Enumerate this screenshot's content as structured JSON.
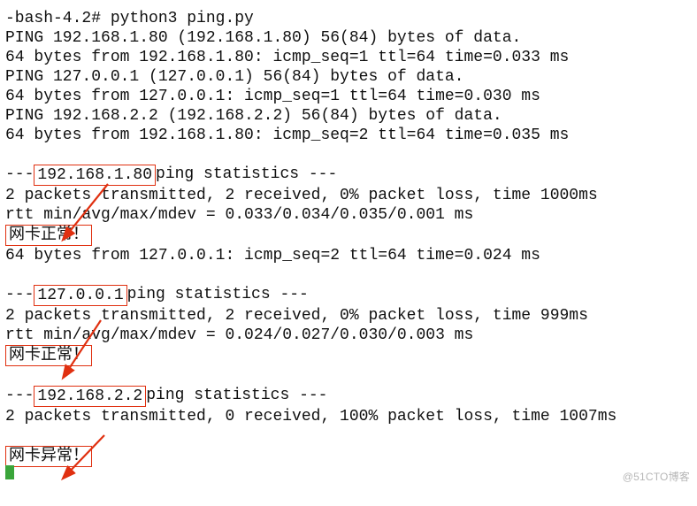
{
  "prompt": "-bash-4.2# python3 ping.py",
  "lines": {
    "ping_a_header": "PING 192.168.1.80 (192.168.1.80) 56(84) bytes of data.",
    "ping_a_reply1": "64 bytes from 192.168.1.80: icmp_seq=1 ttl=64 time=0.033 ms",
    "ping_b_header": "PING 127.0.0.1 (127.0.0.1) 56(84) bytes of data.",
    "ping_b_reply1": "64 bytes from 127.0.0.1: icmp_seq=1 ttl=64 time=0.030 ms",
    "ping_c_header": "PING 192.168.2.2 (192.168.2.2) 56(84) bytes of data.",
    "ping_a_reply2": "64 bytes from 192.168.1.80: icmp_seq=2 ttl=64 time=0.035 ms",
    "ping_b_reply2": "64 bytes from 127.0.0.1: icmp_seq=2 ttl=64 time=0.024 ms"
  },
  "blocks": [
    {
      "sep_prefix": "--- ",
      "ip": "192.168.1.80",
      "sep_suffix": " ping statistics ---",
      "stats": "2 packets transmitted, 2 received, 0% packet loss, time 1000ms",
      "rtt": "rtt min/avg/max/mdev = 0.033/0.034/0.035/0.001 ms",
      "status": "网卡正常！"
    },
    {
      "sep_prefix": "--- ",
      "ip": "127.0.0.1",
      "sep_suffix": " ping statistics ---",
      "stats": "2 packets transmitted, 2 received, 0% packet loss, time 999ms",
      "rtt": "rtt min/avg/max/mdev = 0.024/0.027/0.030/0.003 ms",
      "status": "网卡正常！"
    },
    {
      "sep_prefix": "--- ",
      "ip": "192.168.2.2",
      "sep_suffix": " ping statistics ---",
      "stats": "2 packets transmitted, 0 received, 100% packet loss, time 1007ms",
      "rtt": "",
      "status": "网卡异常！"
    }
  ],
  "watermark": "@51CTO博客",
  "colors": {
    "annotation": "#e03010"
  }
}
